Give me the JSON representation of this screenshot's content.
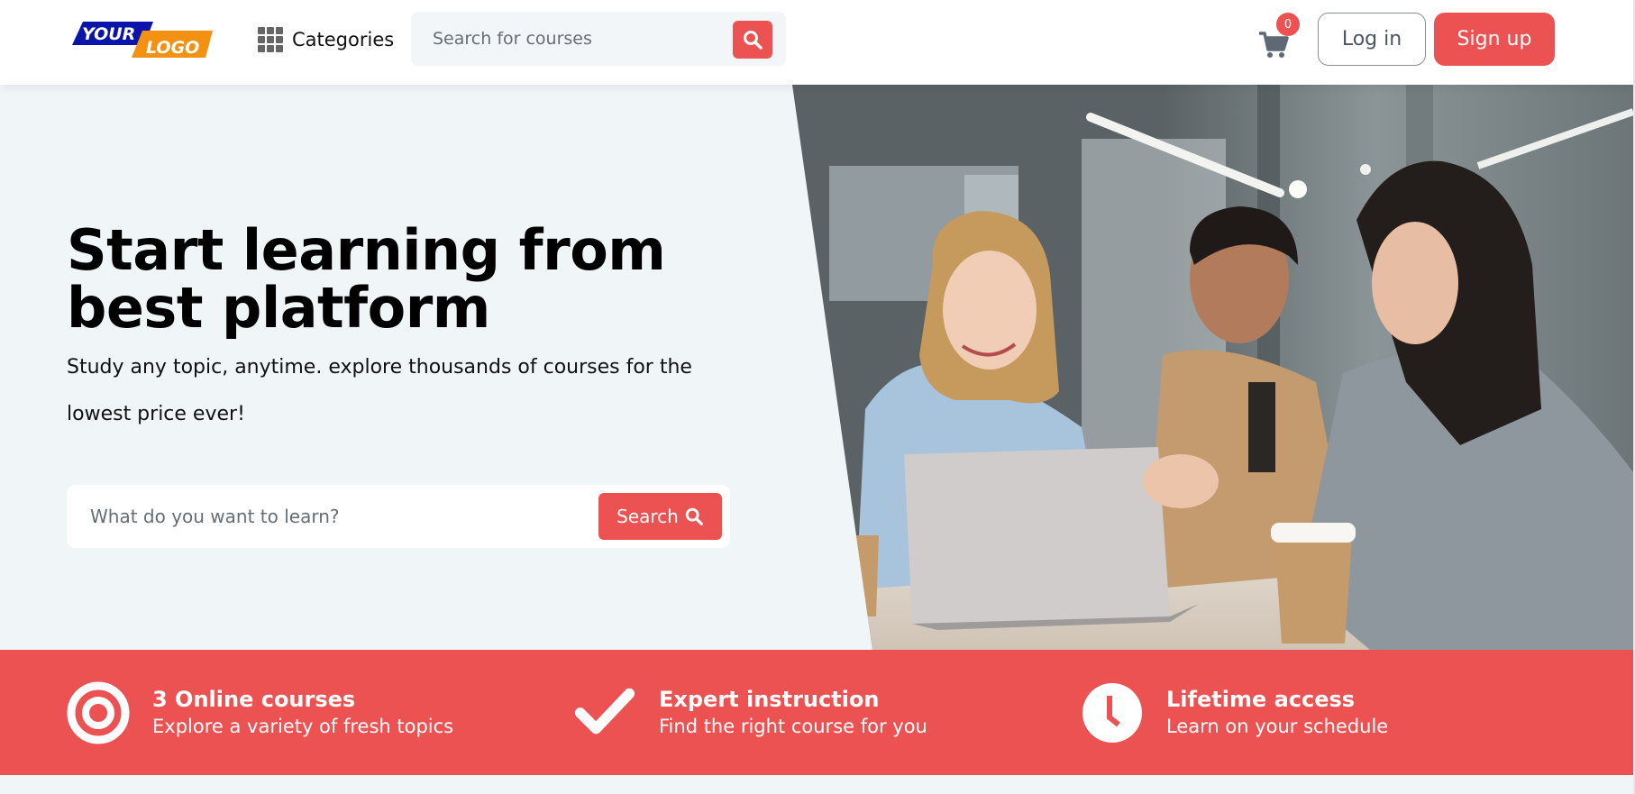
{
  "header": {
    "logo": {
      "word1": "YOUR",
      "word2": "LOGO"
    },
    "categories_label": "Categories",
    "categories_icon": "grid-icon",
    "search": {
      "placeholder": "Search for courses",
      "value": "",
      "icon": "search-icon"
    },
    "cart": {
      "icon": "cart-icon",
      "count": "0"
    },
    "login_label": "Log in",
    "signup_label": "Sign up"
  },
  "hero": {
    "title": "Start learning from best platform",
    "subtitle": "Study any topic, anytime. explore thousands of courses for the lowest price ever!",
    "search": {
      "placeholder": "What do you want to learn?",
      "value": "",
      "button_label": "Search",
      "button_icon": "search-icon"
    },
    "image_description": "Three smiling young people looking at a laptop together in an office, with coffee cups on the table"
  },
  "features": [
    {
      "icon": "target-icon",
      "title": "3 Online courses",
      "description": "Explore a variety of fresh topics"
    },
    {
      "icon": "check-icon",
      "title": "Expert instruction",
      "description": "Find the right course for you"
    },
    {
      "icon": "clock-icon",
      "title": "Lifetime access",
      "description": "Learn on your schedule"
    }
  ],
  "colors": {
    "accent": "#ec5252",
    "logo_blue": "#0a14a8",
    "logo_orange": "#f39112",
    "hero_bg": "#f0f5f8",
    "text": "#111111"
  }
}
